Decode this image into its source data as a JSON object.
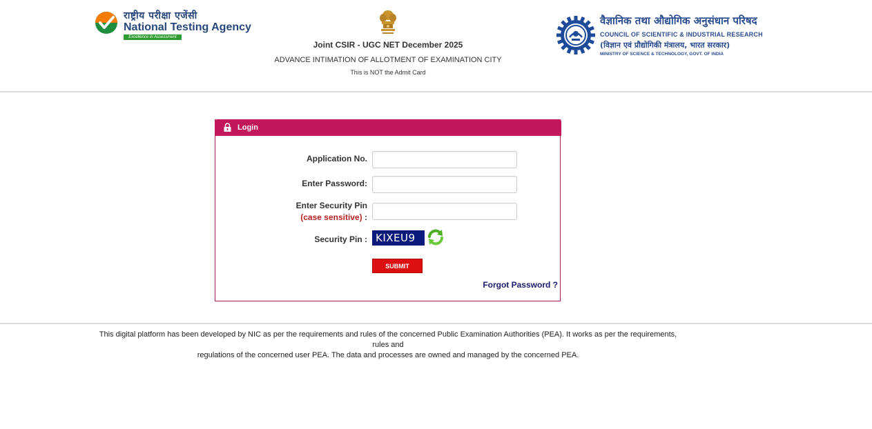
{
  "header": {
    "nta": {
      "hindi": "राष्ट्रीय परीक्षा एजेंसी",
      "english": "National Testing Agency",
      "tagline": "Excellence in Assessment"
    },
    "exam_title": "Joint CSIR - UGC NET December 2025",
    "exam_subtitle": "ADVANCE INTIMATION OF ALLOTMENT OF EXAMINATION CITY",
    "exam_note": "This is NOT the Admit Card",
    "csir": {
      "hindi": "वैज्ञानिक तथा औद्योगिक अनुसंधान परिषद",
      "english": "COUNCIL OF SCIENTIFIC & INDUSTRIAL RESEARCH",
      "hindi_ministry": "(विज्ञान एवं प्रौद्योगिकी मंत्रालय, भारत सरकार)",
      "ministry": "MINISTRY OF SCIENCE & TECHNOLOGY, GOVT. OF INDIA"
    }
  },
  "login": {
    "title": "Login",
    "application_label": "Application No.",
    "application_value": "",
    "password_label": "Enter Password:",
    "password_value": "",
    "security_pin_label": "Enter Security Pin",
    "case_sensitive_label": "(case sensitive)",
    "case_sensitive_colon": " :",
    "security_pin_value": "",
    "captcha_label": "Security Pin :",
    "captcha_value": "KIXEU9",
    "submit_label": "SUBMIT",
    "forgot_label": "Forgot Password ?"
  },
  "footer": {
    "line1": "This digital platform has been developed by NIC as per the requirements and rules of the concerned Public Examination Authorities (PEA). It works as per the requirements, rules and",
    "line2": "regulations of the concerned user PEA. The data and processes are owned and managed by the concerned PEA."
  },
  "colors": {
    "login_header": "#c2185b",
    "submit": "#dc1010",
    "captcha_bg": "#0a1a7a",
    "brand_blue": "#27477b"
  },
  "icons": {
    "nta_emblem": "nta-checkmark-logo-icon",
    "national_emblem": "national-emblem-icon",
    "csir_emblem": "csir-logo-icon",
    "lock": "lock-icon",
    "refresh": "refresh-icon"
  }
}
